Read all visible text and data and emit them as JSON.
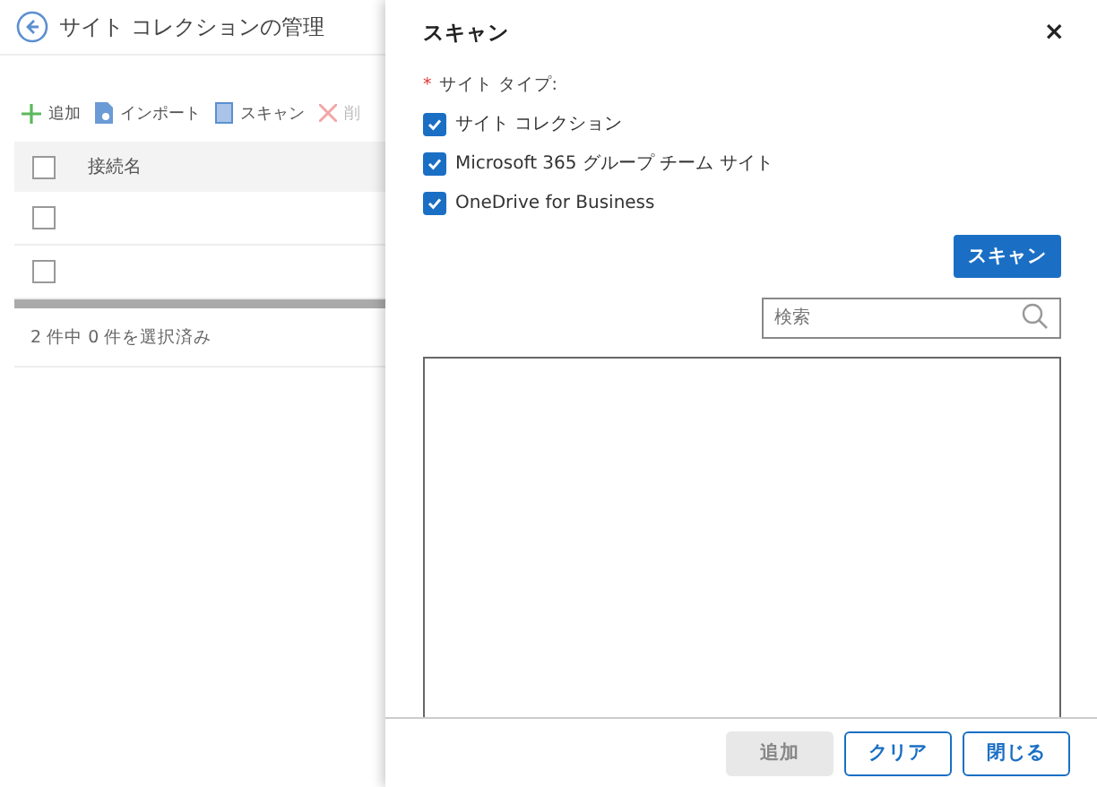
{
  "page": {
    "title": "サイト コレクションの管理",
    "toolbar": [
      {
        "kind": "add",
        "label": "追加",
        "disabled": false
      },
      {
        "kind": "import",
        "label": "インポート",
        "disabled": false
      },
      {
        "kind": "scan",
        "label": "スキャン",
        "disabled": false
      },
      {
        "kind": "delete",
        "label": "削",
        "disabled": true
      }
    ],
    "table": {
      "columns": [
        "接続名"
      ],
      "rows": [
        {
          "checked": false
        },
        {
          "checked": false
        }
      ],
      "header_checked": false
    },
    "footer": "2 件中 0 件を選択済み"
  },
  "dialog": {
    "title": "スキャン",
    "close": "×",
    "required_mark": "*",
    "field_label": "サイト タイプ:",
    "options": [
      {
        "label": "サイト コレクション",
        "checked": true
      },
      {
        "label": "Microsoft 365 グループ チーム サイト",
        "checked": true
      },
      {
        "label": "OneDrive for Business",
        "checked": true
      }
    ],
    "scan_button": "スキャン",
    "search": {
      "placeholder": "検索"
    },
    "buttons": [
      {
        "label": "追加",
        "disabled": true
      },
      {
        "label": "クリア",
        "disabled": false
      },
      {
        "label": "閉じる",
        "disabled": false
      }
    ]
  }
}
